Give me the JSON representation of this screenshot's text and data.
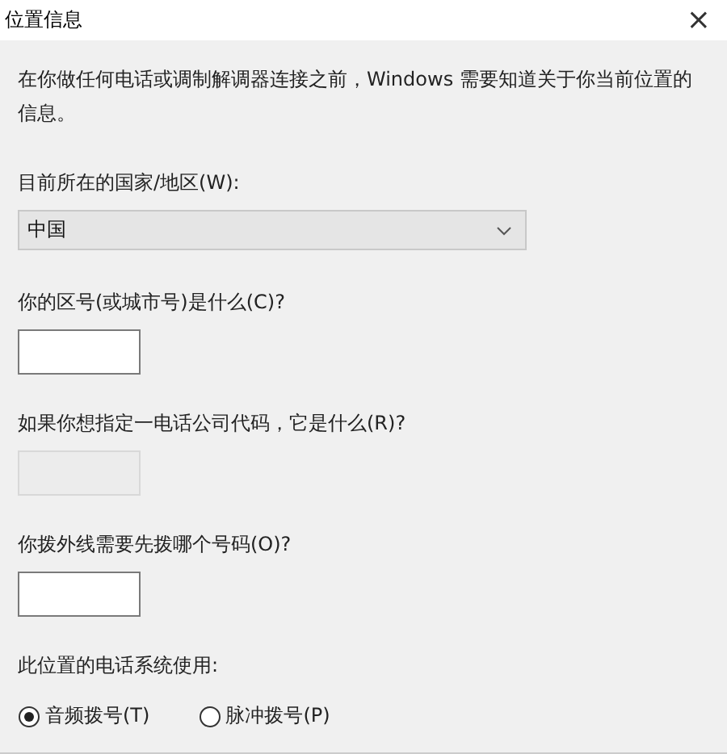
{
  "window": {
    "title": "位置信息",
    "close": "×"
  },
  "intro": "在你做任何电话或调制解调器连接之前，Windows 需要知道关于你当前位置的信息。",
  "country": {
    "label": "目前所在的国家/地区(W):",
    "value": "中国"
  },
  "fields": [
    {
      "label": "你的区号(或城市号)是什么(C)?",
      "disabled": false
    },
    {
      "label": "如果你想指定一电话公司代码，它是什么(R)?",
      "disabled": true
    },
    {
      "label": "你拨外线需要先拨哪个号码(O)?",
      "disabled": false
    }
  ],
  "dialing": {
    "label": "此位置的电话系统使用:",
    "options": [
      {
        "label": "音频拨号(T)",
        "selected": true
      },
      {
        "label": "脉冲拨号(P)",
        "selected": false
      }
    ]
  }
}
